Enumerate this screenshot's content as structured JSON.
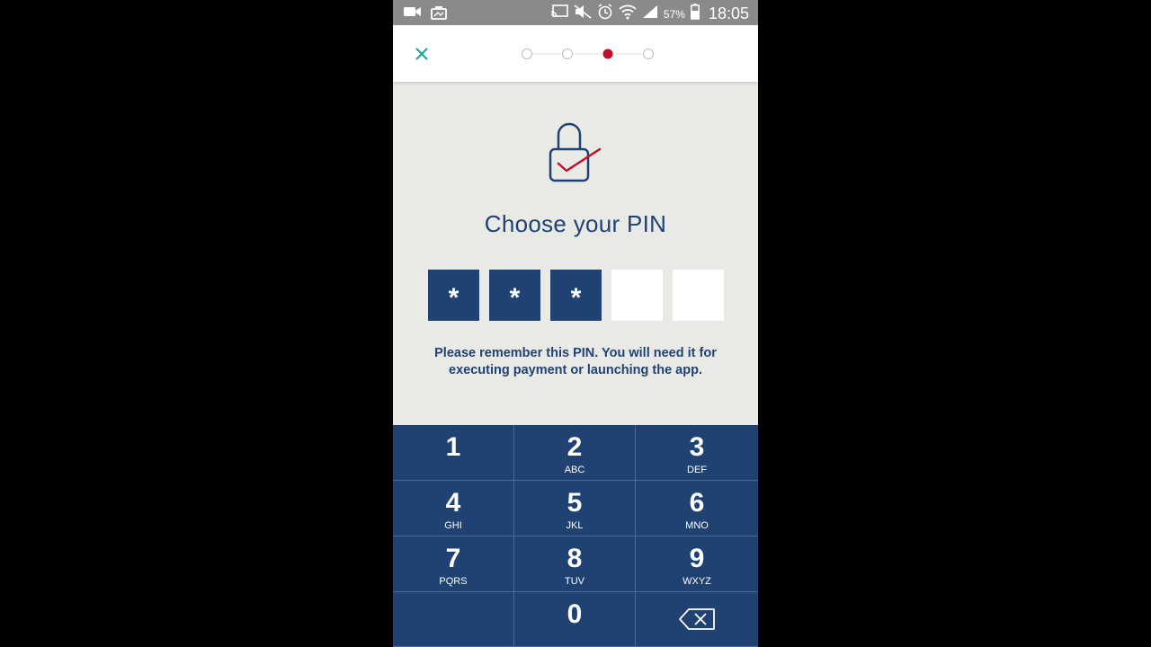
{
  "status_bar": {
    "battery": "57%",
    "time": "18:05",
    "icons": [
      "video-icon",
      "photo-icon",
      "cast-icon",
      "mute-icon",
      "alarm-icon",
      "wifi-icon",
      "signal-icon",
      "battery-icon"
    ]
  },
  "header": {
    "close_icon": "close-icon",
    "steps_total": 4,
    "steps_active": 3
  },
  "content": {
    "title": "Choose your PIN",
    "pin": {
      "length": 5,
      "entered": 3,
      "mask": "*"
    },
    "message": "Please remember this PIN. You will need it for executing payment or launching the app."
  },
  "keypad": {
    "keys": [
      {
        "num": "1",
        "letters": ""
      },
      {
        "num": "2",
        "letters": "ABC"
      },
      {
        "num": "3",
        "letters": "DEF"
      },
      {
        "num": "4",
        "letters": "GHI"
      },
      {
        "num": "5",
        "letters": "JKL"
      },
      {
        "num": "6",
        "letters": "MNO"
      },
      {
        "num": "7",
        "letters": "PQRS"
      },
      {
        "num": "8",
        "letters": "TUV"
      },
      {
        "num": "9",
        "letters": "WXYZ"
      },
      {
        "num": "",
        "letters": ""
      },
      {
        "num": "0",
        "letters": ""
      },
      {
        "num": "",
        "letters": "",
        "icon": "backspace-icon"
      }
    ]
  },
  "colors": {
    "brand_navy": "#1f4273",
    "accent_red": "#c0102a",
    "close_teal": "#1aa58f",
    "background": "#e9eae6"
  }
}
